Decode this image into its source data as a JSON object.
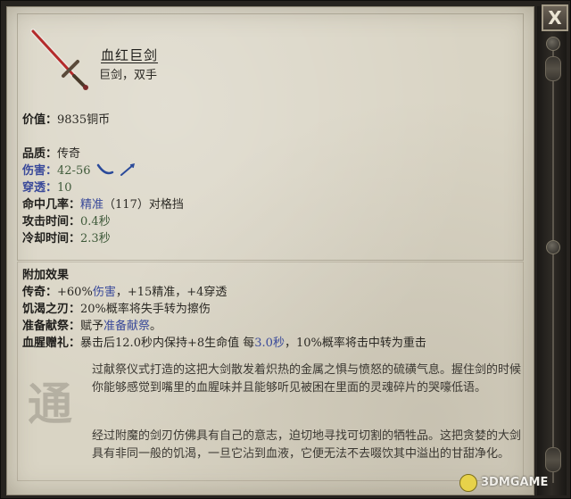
{
  "window": {
    "close_label": "X"
  },
  "item": {
    "name": "血红巨剑",
    "subtitle": "巨剑，双手"
  },
  "stats": {
    "value_label": "价值：",
    "value": "9835铜币",
    "quality_label": "品质：",
    "quality": "传奇",
    "damage_label": "伤害：",
    "damage": "42-56",
    "penetration_label": "穿透：",
    "penetration": "10",
    "accuracy_label": "命中几率：",
    "accuracy_link": "精准",
    "accuracy_rest": "（117）对格挡",
    "attack_time_label": "攻击时间：",
    "attack_time": "0.4秒",
    "cooldown_label": "冷却时间：",
    "cooldown": "2.3秒"
  },
  "effects": {
    "title": "附加效果",
    "legendary_label": "传奇：",
    "legendary_a": "+60%",
    "legendary_b": "伤害",
    "legendary_c": "，+15精准，+4穿透",
    "hunger_label": "饥渴之刃：",
    "hunger": "20%概率将失手转为擦伤",
    "prepared_label": "准备献祭：",
    "prepared_a": "赋予",
    "prepared_b": "准备献祭",
    "prepared_c": "。",
    "gift_label": "血腥赠礼：",
    "gift_a": "暴击后12.0秒内保持+8生命值  每",
    "gift_b": "3.0秒",
    "gift_c": "，10%概率将击中转为重击"
  },
  "flavor": {
    "p1": "过献祭仪式打造的这把大剑散发着炽热的金属之惧与愤怒的硫磺气息。握住剑的时候你能够感觉到嘴里的血腥味并且能够听见被困在里面的灵魂碎片的哭嚎低语。",
    "p2": "经过附魔的剑刃仿佛具有自己的意志，迫切地寻找可切割的牺牲品。这把贪婪的大剑具有非同一般的饥渴，一旦它沾到血液，它便无法不去啜饮其中溢出的甘甜净化。"
  },
  "watermark": "通",
  "logo": "3DMGAME",
  "colors": {
    "parchment": "#d9d4c4",
    "link_blue": "#3a4a9a",
    "value_green": "#3f5a3a",
    "blade_red": "#b42b2b"
  },
  "icons": {
    "item": "greatsword-icon",
    "damage_types": [
      "slash-icon",
      "pierce-icon"
    ],
    "close": "close-icon"
  }
}
